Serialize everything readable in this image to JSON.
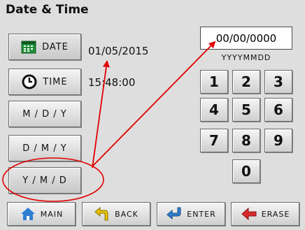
{
  "title": "Date & Time",
  "date": {
    "label": "DATE",
    "value": "01/05/2015"
  },
  "time": {
    "label": "TIME",
    "value": "15:48:00"
  },
  "formats": [
    "M / D / Y",
    "D / M / Y",
    "Y / M / D"
  ],
  "entry": {
    "value": "00/00/0000",
    "format_hint": "YYYYMMDD"
  },
  "keypad": [
    "1",
    "2",
    "3",
    "4",
    "5",
    "6",
    "7",
    "8",
    "9",
    "0"
  ],
  "bottom_bar": {
    "main": "MAIN",
    "back": "BACK",
    "enter": "ENTER",
    "erase": "ERASE"
  },
  "icons": {
    "date": "calendar-icon",
    "time": "clock-icon",
    "main": "home-icon",
    "back": "back-arrow-icon",
    "enter": "enter-arrow-icon",
    "erase": "erase-arrow-icon"
  },
  "colors": {
    "annotation": "#e00000",
    "calendar": "#1f8f3a",
    "home": "#2e7fd1",
    "back": "#e6c200",
    "enter": "#2e7fd1",
    "erase": "#d62b2b"
  }
}
